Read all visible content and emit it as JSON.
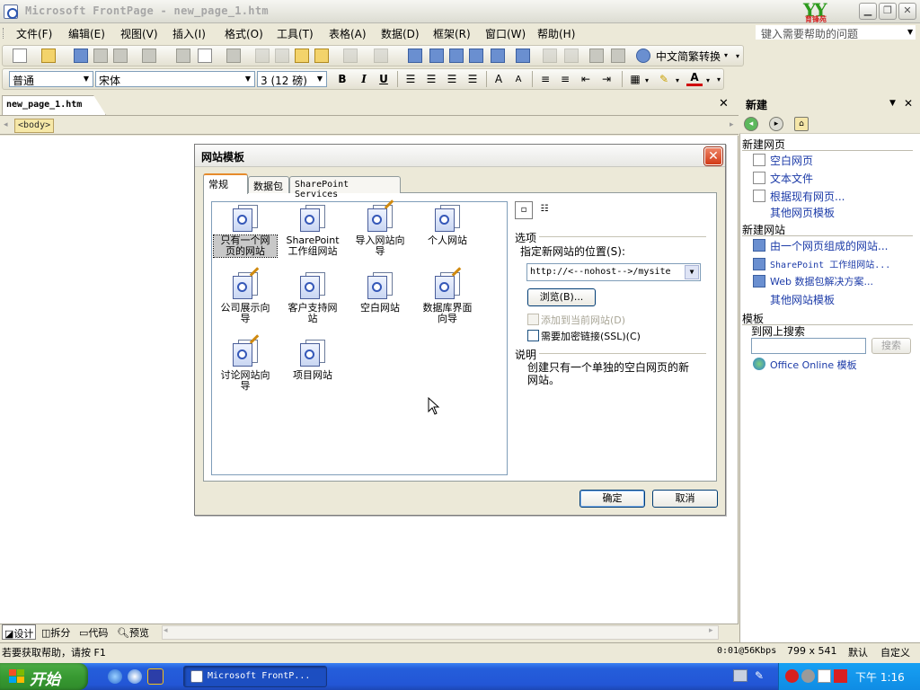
{
  "window": {
    "title": "Microsoft FrontPage - new_page_1.htm",
    "logo_small": "育锋苑"
  },
  "menubar": {
    "items": [
      "文件(F)",
      "编辑(E)",
      "视图(V)",
      "插入(I)",
      "格式(O)",
      "工具(T)",
      "表格(A)",
      "数据(D)",
      "框架(R)",
      "窗口(W)",
      "帮助(H)"
    ],
    "help_box": "键入需要帮助的问题"
  },
  "toolbar": {
    "convert_label": "中文简繁转换"
  },
  "format_toolbar": {
    "style": "普通",
    "font": "宋体",
    "size": "3 (12 磅)",
    "bold": "B",
    "italic": "I",
    "underline": "U"
  },
  "document": {
    "tab": "new_page_1.htm",
    "quick_tag": "<body>"
  },
  "view_tabs": [
    "设计",
    "拆分",
    "代码",
    "预览"
  ],
  "status": {
    "left": "若要获取帮助，请按 F1",
    "speed": "0:01@56Kbps",
    "size": "799 x 541",
    "mode1": "默认",
    "mode2": "自定义"
  },
  "taskpane": {
    "title": "新建",
    "sections": {
      "new_page": "新建网页",
      "new_site": "新建网站",
      "templates": "模板"
    },
    "page_links": [
      "空白网页",
      "文本文件",
      "根据现有网页...",
      "其他网页模板"
    ],
    "site_links": [
      "由一个网页组成的网站...",
      "SharePoint 工作组网站...",
      "Web 数据包解决方案...",
      "其他网站模板"
    ],
    "search_label": "到网上搜索",
    "search_button": "搜索",
    "office_online": "Office Online 模板"
  },
  "dialog": {
    "title": "网站模板",
    "tabs": [
      "常规",
      "数据包",
      "SharePoint Services"
    ],
    "templates": [
      [
        "只有一个网",
        "页的网站"
      ],
      [
        "SharePoint",
        "工作组网站"
      ],
      [
        "导入网站向",
        "导"
      ],
      [
        "个人网站"
      ],
      [
        "公司展示向",
        "导"
      ],
      [
        "客户支持网",
        "站"
      ],
      [
        "空白网站"
      ],
      [
        "数据库界面",
        "向导"
      ],
      [
        "讨论网站向",
        "导"
      ],
      [
        "项目网站"
      ]
    ],
    "options_label": "选项",
    "location_label": "指定新网站的位置(S):",
    "location_value": "http://<--nohost-->/mysite",
    "browse_button": "浏览(B)...",
    "add_to_current": "添加到当前网站(D)",
    "ssl_label": "需要加密链接(SSL)(C)",
    "description_label": "说明",
    "description_text": "创建只有一个单独的空白网页的新网站。",
    "ok_button": "确定",
    "cancel_button": "取消"
  },
  "taskbar": {
    "start": "开始",
    "task_button": "Microsoft FrontP...",
    "clock": "下午 1:16"
  }
}
